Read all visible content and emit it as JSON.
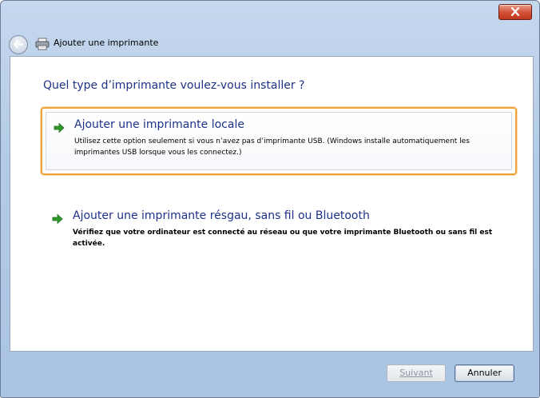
{
  "window": {
    "close_icon": "close-x-icon"
  },
  "nav": {
    "back_icon": "back-arrow-icon",
    "printer_icon": "printer-icon",
    "title": "Ajouter une imprimante"
  },
  "main": {
    "heading": "Quel type d’imprimante voulez-vous installer ?",
    "options": [
      {
        "icon": "green-arrow-icon",
        "title": "Ajouter une imprimante locale",
        "description": "Utilisez cette option seulement si vous n’avez pas d’imprimante USB. (Windows installe automatiquement les imprimantes USB lorsque vous les connectez.)",
        "selected": true
      },
      {
        "icon": "green-arrow-icon",
        "title": "Ajouter une imprimante résgau, sans fil ou Bluetooth",
        "description": "Vérifiez que votre ordinateur est connecté au réseau ou que votre imprimante Bluetooth ou sans fil est activée.",
        "selected": false
      }
    ]
  },
  "footer": {
    "next_label": "Suivant",
    "cancel_label": "Annuler"
  },
  "colors": {
    "link_blue": "#1e3287",
    "selection_orange": "#f0a33a",
    "close_red": "#c0381e"
  }
}
